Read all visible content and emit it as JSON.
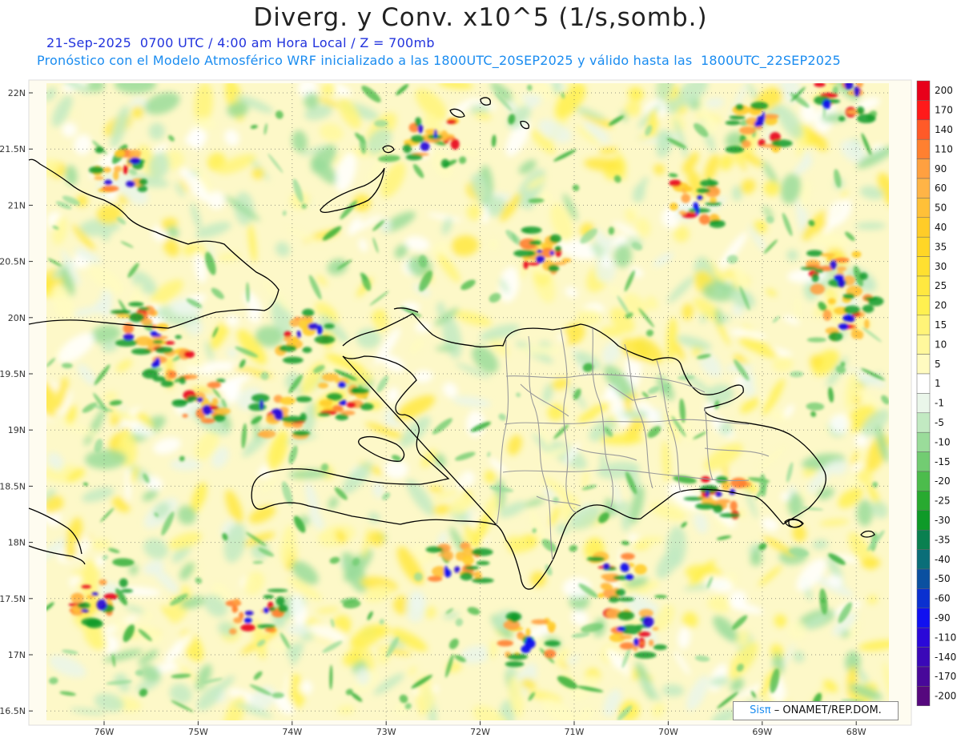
{
  "title": "Diverg. y Conv. x10^5 (1/s,somb.)",
  "subtitle_time": "21-Sep-2025  0700 UTC / 4:00 am Hora Local / Z = 700mb",
  "subtitle_model": "Pronóstico con el Modelo Atmosférico WRF inicializado a las 1800UTC_20SEP2025 y válido hasta las  1800UTC_22SEP2025",
  "axes": {
    "lat_labels": [
      "22N",
      "21.5N",
      "21N",
      "20.5N",
      "20N",
      "19.5N",
      "19N",
      "18.5N",
      "18N",
      "17.5N",
      "17N",
      "16.5N"
    ],
    "lon_labels": [
      "76W",
      "75W",
      "74W",
      "73W",
      "72W",
      "71W",
      "70W",
      "69W",
      "68W"
    ]
  },
  "colorbar": {
    "labels": [
      "200",
      "170",
      "140",
      "110",
      "90",
      "60",
      "50",
      "40",
      "35",
      "30",
      "25",
      "20",
      "15",
      "10",
      "5",
      "1",
      "-1",
      "-5",
      "-10",
      "-15",
      "-20",
      "-25",
      "-30",
      "-35",
      "-40",
      "-50",
      "-60",
      "-90",
      "-110",
      "-140",
      "-170",
      "-200"
    ],
    "colors": [
      "#e8001a",
      "#ff1a1a",
      "#ff5a28",
      "#ff8030",
      "#ffa040",
      "#ffb446",
      "#ffc038",
      "#ffcc28",
      "#ffd626",
      "#ffe030",
      "#ffe840",
      "#fff050",
      "#fff478",
      "#fff89c",
      "#fffbc0",
      "#ffffff",
      "#eaf6ea",
      "#c2eac2",
      "#9adc9a",
      "#72cc72",
      "#4cbc4c",
      "#28aa30",
      "#0e9a28",
      "#0a8050",
      "#0a6e78",
      "#0a50a0",
      "#0a30d0",
      "#1010f0",
      "#2a08d8",
      "#3a08b8",
      "#48089a",
      "#56087e"
    ]
  },
  "credit": {
    "brand": "Sisπ",
    "text": "– ONAMET/REP.DOM."
  }
}
